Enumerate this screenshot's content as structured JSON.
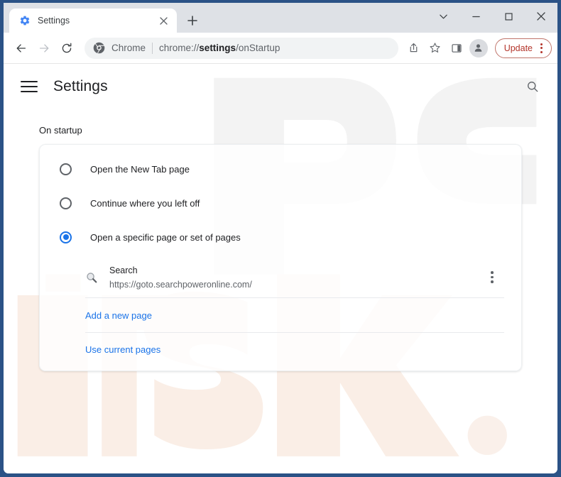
{
  "window": {
    "frame_color": "#2b5286",
    "controls": [
      {
        "name": "tab-search",
        "glyph": "chevron-down"
      },
      {
        "name": "minimize",
        "glyph": "minus"
      },
      {
        "name": "maximize",
        "glyph": "square"
      },
      {
        "name": "close",
        "glyph": "x"
      }
    ]
  },
  "tabstrip": {
    "tab": {
      "title": "Settings",
      "favicon": "gear-icon",
      "close_label": "×"
    },
    "new_tab_label": "+"
  },
  "toolbar": {
    "back_label": "Back",
    "forward_label": "Forward",
    "reload_label": "Reload",
    "omnibox": {
      "chip_label": "Chrome",
      "url_prefix": "chrome://",
      "url_bold": "settings",
      "url_suffix": "/onStartup",
      "full_url": "chrome://settings/onStartup"
    },
    "share_label": "Share this page",
    "bookmark_label": "Bookmark this tab",
    "side_panel_label": "Side panel",
    "profile_label": "Profile",
    "update": {
      "label": "Update",
      "accent": "#b3342a",
      "border": "#c0756b"
    }
  },
  "settings_page": {
    "title": "Settings",
    "menu_label": "Main menu",
    "search_label": "Search settings",
    "section_label": "On startup",
    "accent": "#1a73e8",
    "options": [
      {
        "label": "Open the New Tab page",
        "selected": false
      },
      {
        "label": "Continue where you left off",
        "selected": false
      },
      {
        "label": "Open a specific page or set of pages",
        "selected": true
      }
    ],
    "startup_page": {
      "title": "Search",
      "url": "https://goto.searchpoweronline.com/",
      "favicon": "magnifier-icon",
      "menu_label": "More actions"
    },
    "add_page_link": "Add a new page",
    "use_current_link": "Use current pages"
  },
  "watermark": {
    "text_top": "PC",
    "text_bottom": "risk.com",
    "color": "#f5e9e2"
  }
}
